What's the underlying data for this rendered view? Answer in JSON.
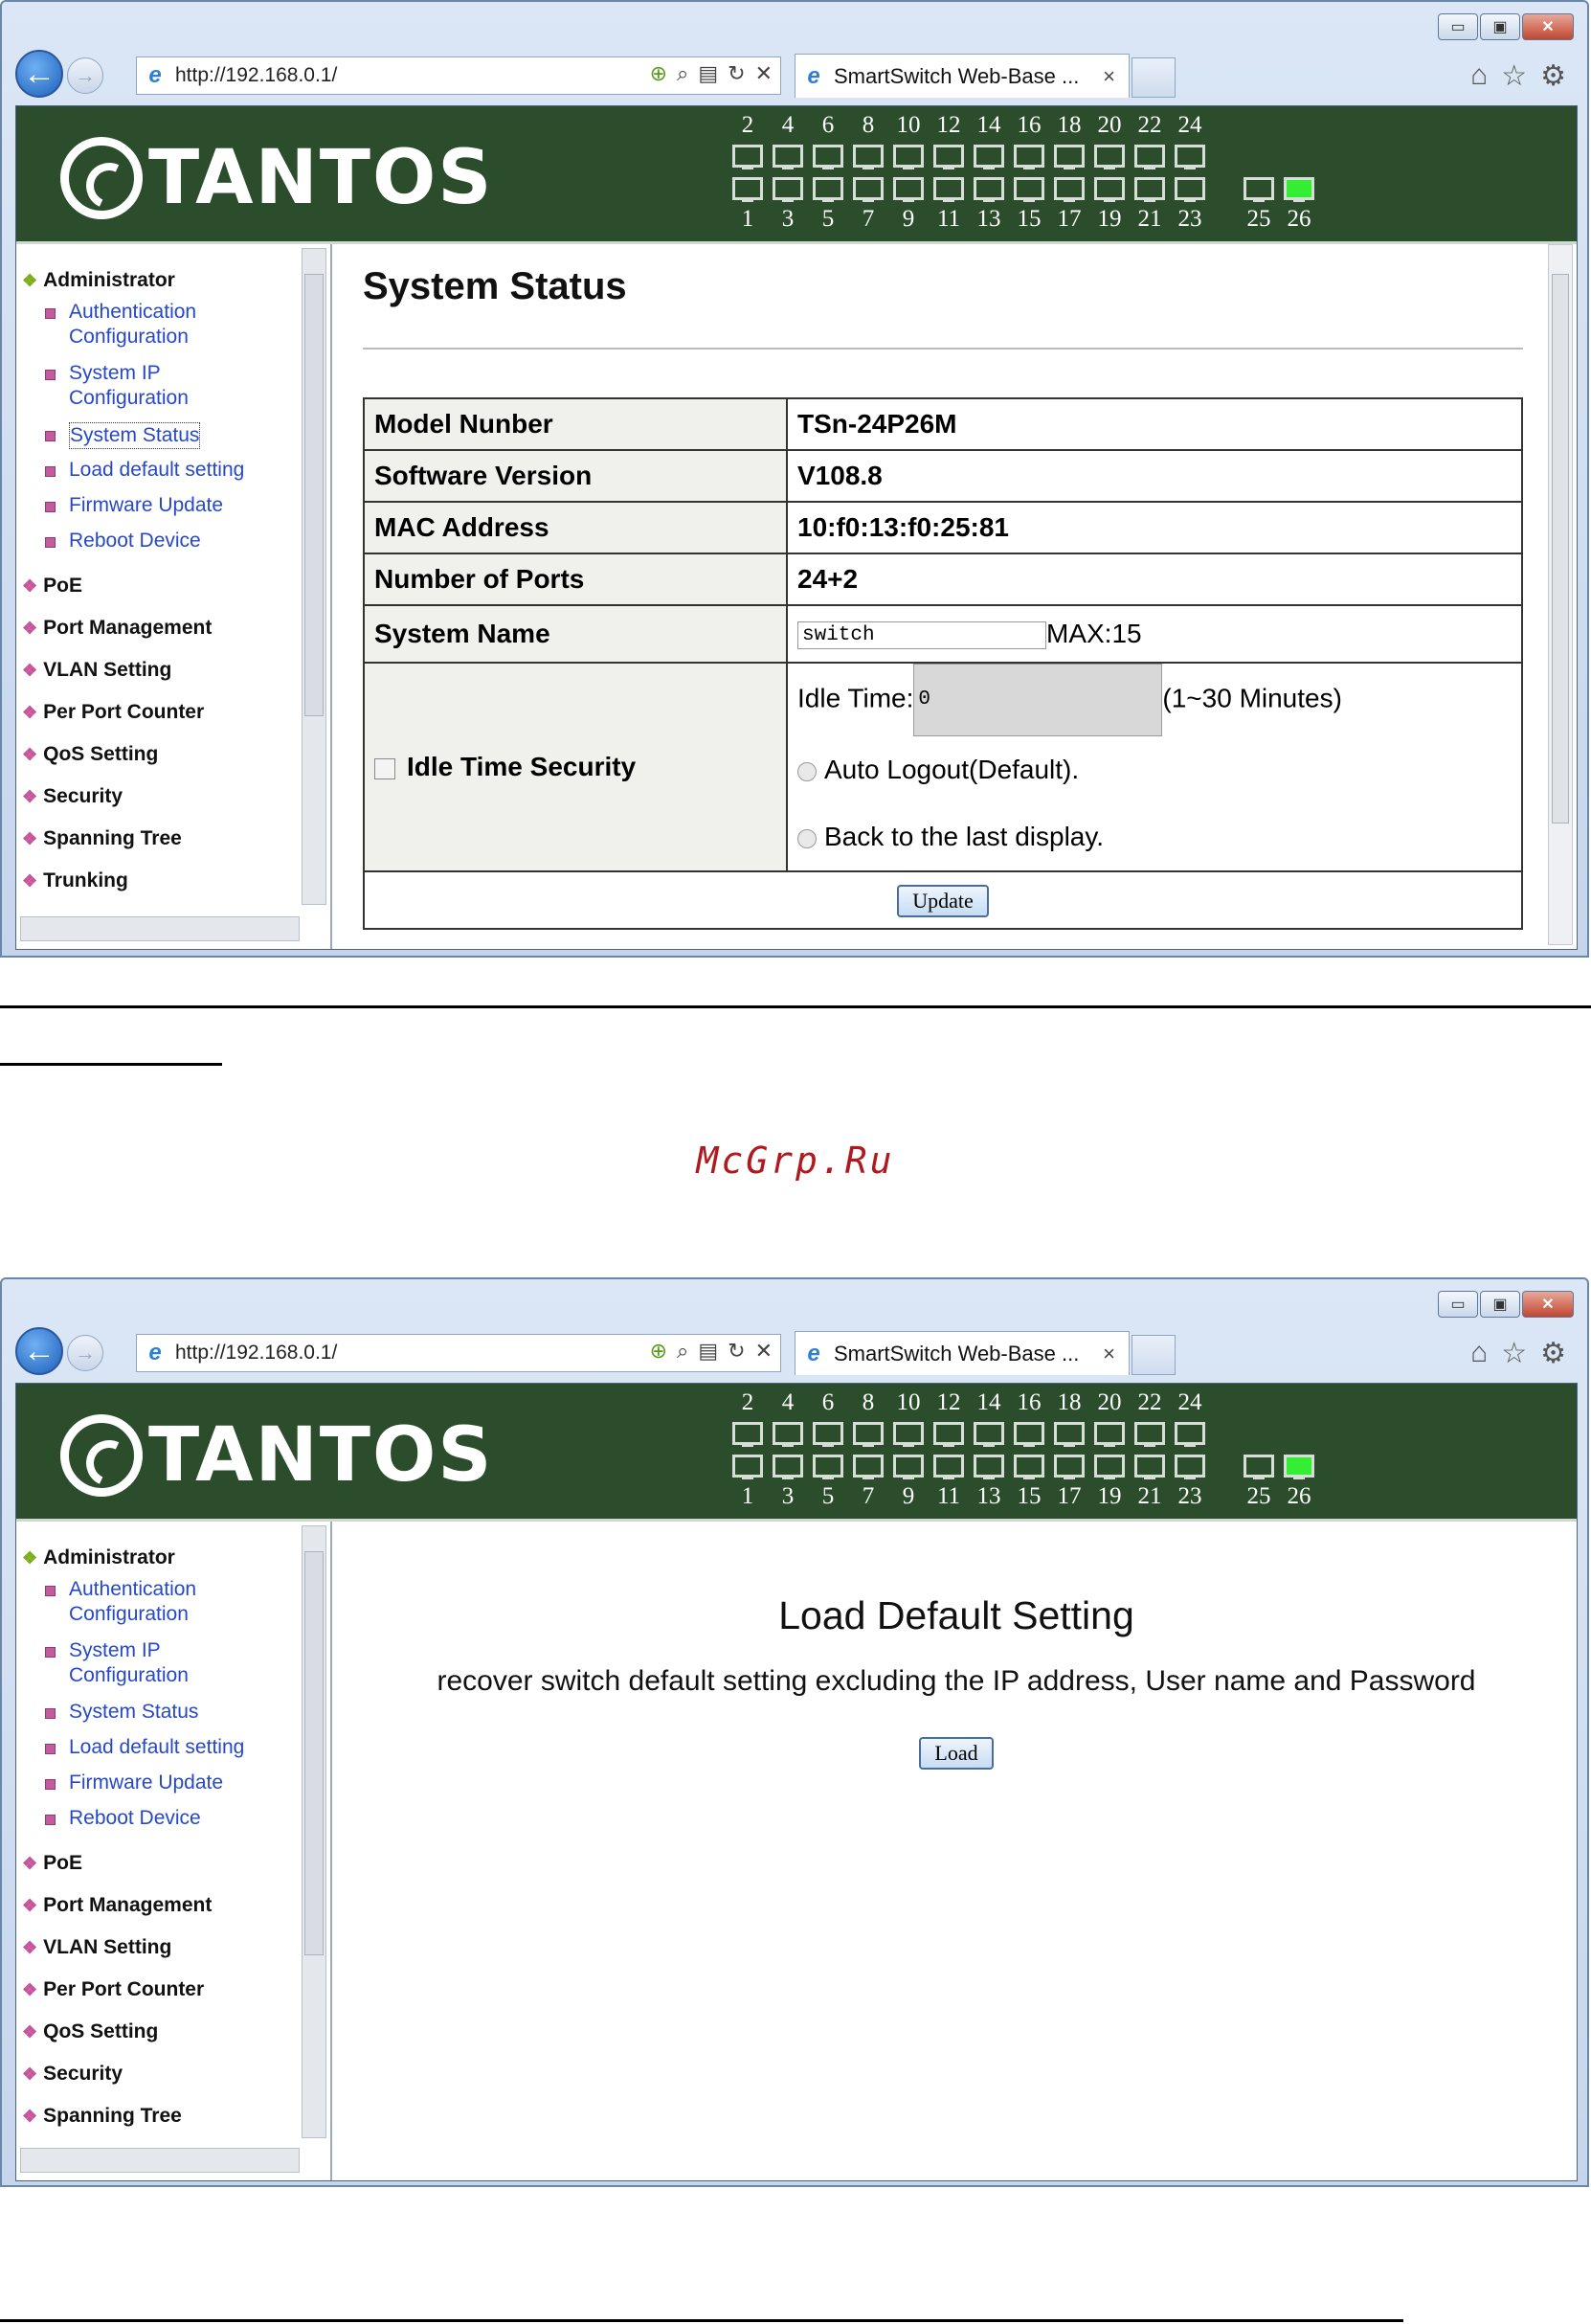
{
  "browser": {
    "url": "http://192.168.0.1/",
    "tab_title": "SmartSwitch Web-Base ...",
    "tab_close": "×",
    "min_btn": "▭",
    "max_btn": "▣",
    "close_btn": "✕"
  },
  "brand": {
    "name": "TANTOS"
  },
  "ports": {
    "top_labels": [
      "2",
      "4",
      "6",
      "8",
      "10",
      "12",
      "14",
      "16",
      "18",
      "20",
      "22",
      "24"
    ],
    "bottom_labels": [
      "1",
      "3",
      "5",
      "7",
      "9",
      "11",
      "13",
      "15",
      "17",
      "19",
      "21",
      "23"
    ],
    "uplink_labels": [
      "25",
      "26"
    ],
    "uplink_link": [
      false,
      true
    ]
  },
  "sidebar": {
    "administrator": "Administrator",
    "items": [
      {
        "line1": "Authentication",
        "line2": "Configuration"
      },
      {
        "line1": "System IP",
        "line2": "Configuration"
      },
      {
        "line1": "System Status"
      },
      {
        "line1": "Load default setting"
      },
      {
        "line1": "Firmware Update"
      },
      {
        "line1": "Reboot Device"
      }
    ],
    "sections": [
      "PoE",
      "Port Management",
      "VLAN Setting",
      "Per Port Counter",
      "QoS Setting",
      "Security",
      "Spanning Tree",
      "Trunking"
    ]
  },
  "status_page": {
    "title": "System Status",
    "rows": {
      "model_label": "Model Nunber",
      "model_value": "TSn-24P26M",
      "sw_label": "Software Version",
      "sw_value": "V108.8",
      "mac_label": "MAC Address",
      "mac_value": "10:f0:13:f0:25:81",
      "ports_label": "Number of Ports",
      "ports_value": "24+2",
      "name_label": "System Name",
      "name_value": "switch",
      "name_max": "MAX:15",
      "idle_label": "Idle Time Security",
      "idle_time_label": "Idle Time:",
      "idle_time_value": "0",
      "idle_time_range": "(1~30 Minutes)",
      "opt_auto": "Auto Logout(Default).",
      "opt_back": "Back to the last display."
    },
    "update_button": "Update"
  },
  "watermark": "McGrp.Ru",
  "load_page": {
    "title": "Load Default Setting",
    "description": "recover switch default setting excluding the IP address, User name and Password",
    "load_button": "Load"
  }
}
